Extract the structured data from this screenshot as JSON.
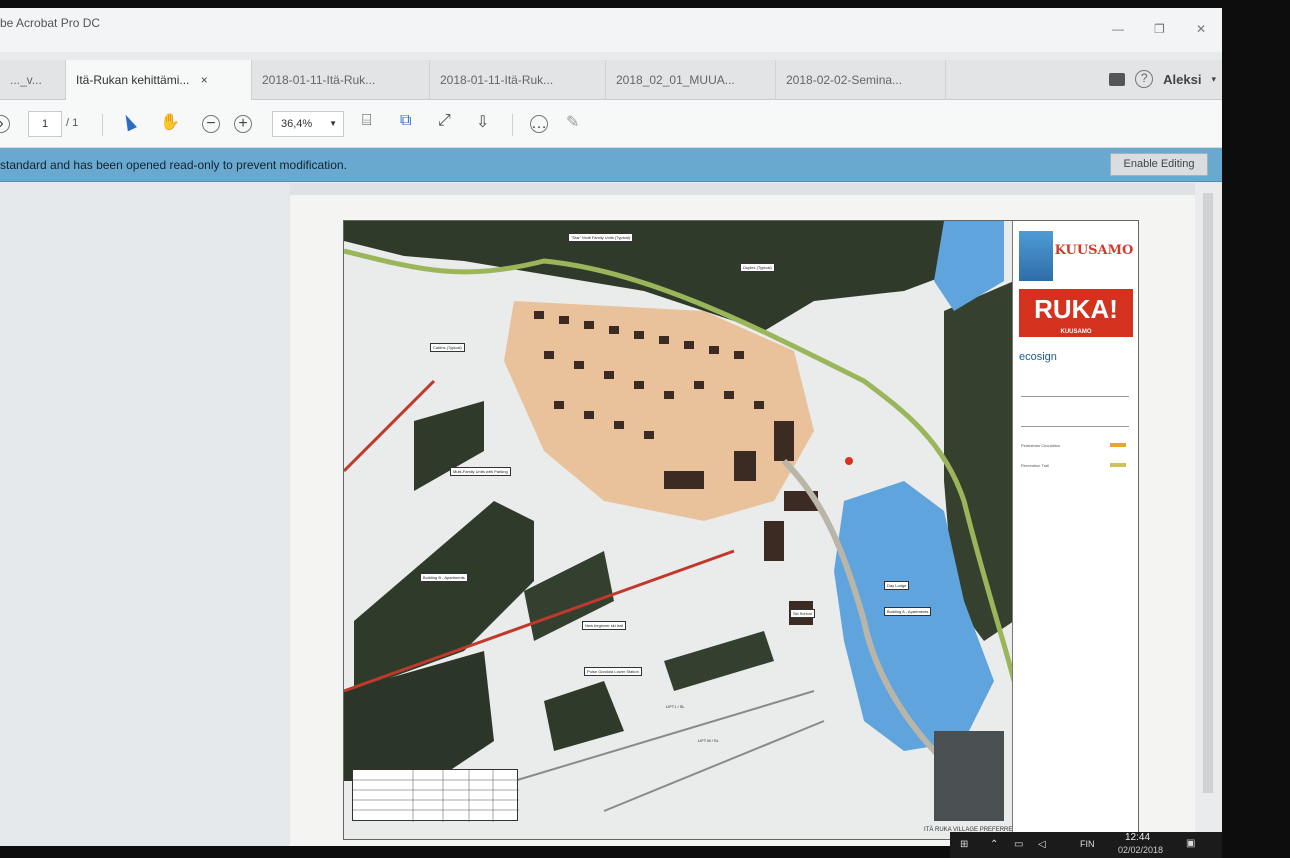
{
  "window": {
    "app_title": "be Acrobat Pro DC",
    "minimize": "—",
    "restore": "❐",
    "close": "✕"
  },
  "tabs": [
    {
      "label": "..._v..."
    },
    {
      "label": "Itä-Rukan kehittämi...",
      "close": "×"
    },
    {
      "label": "2018-01-11-Itä-Ruk..."
    },
    {
      "label": "2018-01-11-Itä-Ruk..."
    },
    {
      "label": "2018_02_01_MUUA..."
    },
    {
      "label": "2018-02-02-Semina..."
    }
  ],
  "account": {
    "user": "Aleksi",
    "help": "?"
  },
  "toolbar": {
    "page_current": "1",
    "page_total": "/ 1",
    "zoom": "36,4%"
  },
  "infobar": {
    "message": "standard and has been opened read-only to prevent modification.",
    "button": "Enable Editing"
  },
  "map": {
    "title": "ITÄ RUKA VILLAGE PREFERRED CONCEPT",
    "logos": {
      "kuusamo": "KUUSAMO",
      "rukai": "RUKA!",
      "rukai_sub": "KUUSAMO",
      "eco": "ecosign"
    },
    "labels": [
      "\"Star\" Multi Family Units (Typical)",
      "Duplex (Typical)",
      "Cabins (Typical)",
      "Multi-Family Units with Parking",
      "Building B - Apartments",
      "New beginner ski trail",
      "Pulse Gondola Lower Station",
      "Building A - Apartments",
      "Day Lodge",
      "Ski School",
      "LIFT I / SL",
      "LIFT M / SL"
    ],
    "legend": [
      "Pedestrian Circulation",
      "Recreation Trail"
    ],
    "legend_colors": {
      "pedestrian": "#e8a33a",
      "trail": "#c9c35a"
    }
  },
  "taskbar": {
    "lang": "FIN",
    "time": "12:44",
    "date": "02/02/2018"
  },
  "colors": {
    "infobar": "#6aa9cf",
    "accent_red": "#d5311f",
    "forest": "#2f3a2b",
    "water": "#5fa4dc"
  }
}
